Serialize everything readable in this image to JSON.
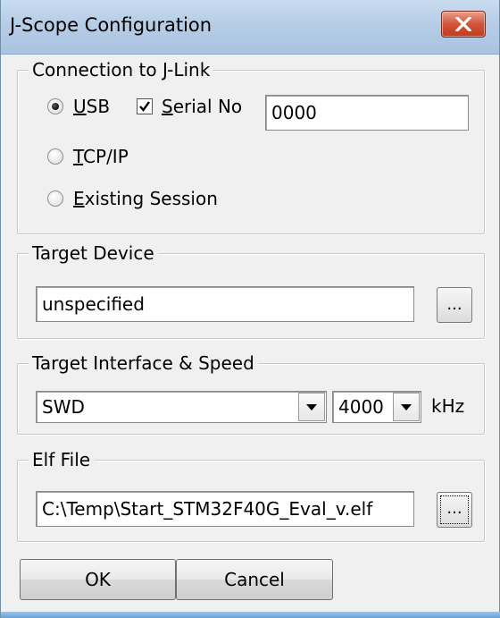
{
  "window": {
    "title": "J-Scope Configuration",
    "close_icon": "close-x-icon"
  },
  "connection": {
    "legend": "Connection to J-Link",
    "usb": {
      "label_u": "U",
      "label_rest": "SB",
      "selected": true
    },
    "serial_no": {
      "label_u": "S",
      "label_rest": "erial No",
      "checked": true
    },
    "serial_value": "0000",
    "tcpip": {
      "label_u": "T",
      "label_rest": "CP/IP",
      "selected": false
    },
    "existing": {
      "label_u": "E",
      "label_rest": "xisting Session",
      "selected": false
    }
  },
  "target_device": {
    "legend": "Target Device",
    "value": "unspecified",
    "browse_label": "..."
  },
  "interface": {
    "legend": "Target Interface & Speed",
    "selected": "SWD",
    "speed": "4000",
    "unit": "kHz"
  },
  "elf": {
    "legend": "Elf File",
    "path": "C:\\Temp\\Start_STM32F40G_Eval_v.elf",
    "browse_label": "..."
  },
  "buttons": {
    "ok": "OK",
    "cancel": "Cancel"
  }
}
